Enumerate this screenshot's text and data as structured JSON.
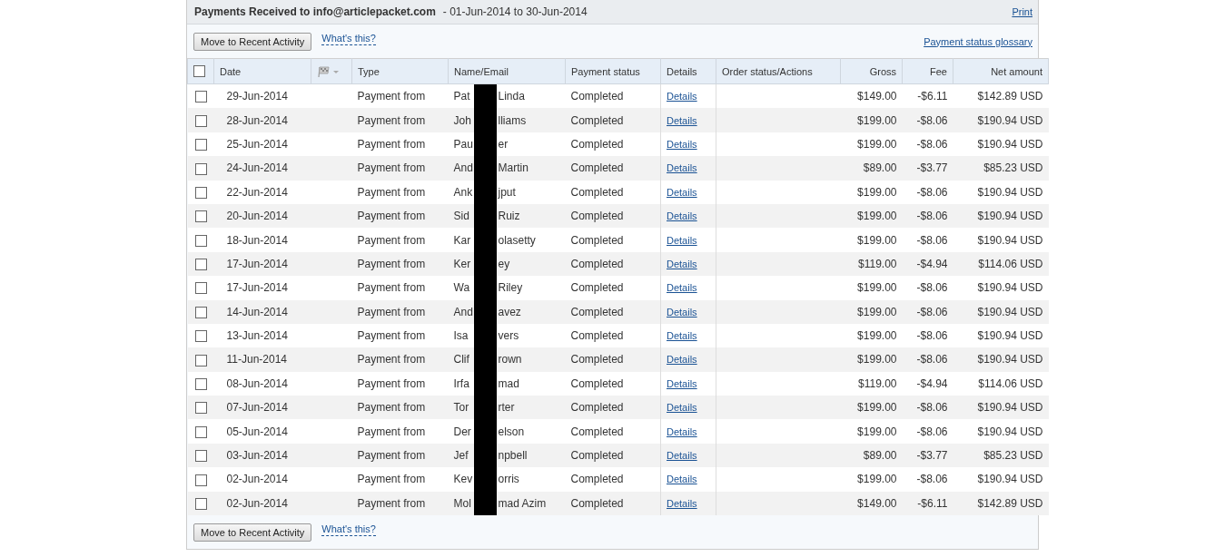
{
  "header": {
    "title": "Payments Received to info@articlepacket.com",
    "date_range": "- 01-Jun-2014 to 30-Jun-2014",
    "print_link": "Print"
  },
  "toolbar_top": {
    "button": "Move to Recent Activity",
    "help_link": "What's this?",
    "glossary_link": "Payment status glossary"
  },
  "table": {
    "select_all": {
      "checked": false
    },
    "columns": [
      "Date",
      "Type",
      "Name/Email",
      "Payment status",
      "Details",
      "Order status/Actions",
      "Gross",
      "Fee",
      "Net amount"
    ],
    "rows": [
      {
        "checked": false,
        "date": "29-Jun-2014",
        "type": "Payment from",
        "name_start": "Pat",
        "name_end": "Linda",
        "status": "Completed",
        "details": "Details",
        "gross": "$149.00",
        "fee": "-$6.11",
        "net": "$142.89 USD"
      },
      {
        "checked": false,
        "date": "28-Jun-2014",
        "type": "Payment from",
        "name_start": "Joh",
        "name_end": "lliams",
        "status": "Completed",
        "details": "Details",
        "gross": "$199.00",
        "fee": "-$8.06",
        "net": "$190.94 USD"
      },
      {
        "checked": false,
        "date": "25-Jun-2014",
        "type": "Payment from",
        "name_start": "Pau",
        "name_end": "er",
        "status": "Completed",
        "details": "Details",
        "gross": "$199.00",
        "fee": "-$8.06",
        "net": "$190.94 USD"
      },
      {
        "checked": false,
        "date": "24-Jun-2014",
        "type": "Payment from",
        "name_start": "And",
        "name_end": "Martin",
        "status": "Completed",
        "details": "Details",
        "gross": "$89.00",
        "fee": "-$3.77",
        "net": "$85.23 USD"
      },
      {
        "checked": false,
        "date": "22-Jun-2014",
        "type": "Payment from",
        "name_start": "Ank",
        "name_end": "jput",
        "status": "Completed",
        "details": "Details",
        "gross": "$199.00",
        "fee": "-$8.06",
        "net": "$190.94 USD"
      },
      {
        "checked": false,
        "date": "20-Jun-2014",
        "type": "Payment from",
        "name_start": "Sid",
        "name_end": "Ruiz",
        "status": "Completed",
        "details": "Details",
        "gross": "$199.00",
        "fee": "-$8.06",
        "net": "$190.94 USD"
      },
      {
        "checked": false,
        "date": "18-Jun-2014",
        "type": "Payment from",
        "name_start": "Kar",
        "name_end": "olasetty",
        "status": "Completed",
        "details": "Details",
        "gross": "$199.00",
        "fee": "-$8.06",
        "net": "$190.94 USD"
      },
      {
        "checked": false,
        "date": "17-Jun-2014",
        "type": "Payment from",
        "name_start": "Ker",
        "name_end": "ey",
        "status": "Completed",
        "details": "Details",
        "gross": "$119.00",
        "fee": "-$4.94",
        "net": "$114.06 USD"
      },
      {
        "checked": false,
        "date": "17-Jun-2014",
        "type": "Payment from",
        "name_start": "Wa",
        "name_end": "Riley",
        "status": "Completed",
        "details": "Details",
        "gross": "$199.00",
        "fee": "-$8.06",
        "net": "$190.94 USD"
      },
      {
        "checked": false,
        "date": "14-Jun-2014",
        "type": "Payment from",
        "name_start": "And",
        "name_end": "avez",
        "status": "Completed",
        "details": "Details",
        "gross": "$199.00",
        "fee": "-$8.06",
        "net": "$190.94 USD"
      },
      {
        "checked": false,
        "date": "13-Jun-2014",
        "type": "Payment from",
        "name_start": "Isa",
        "name_end": "vers",
        "status": "Completed",
        "details": "Details",
        "gross": "$199.00",
        "fee": "-$8.06",
        "net": "$190.94 USD"
      },
      {
        "checked": false,
        "date": "11-Jun-2014",
        "type": "Payment from",
        "name_start": "Clif",
        "name_end": "rown",
        "status": "Completed",
        "details": "Details",
        "gross": "$199.00",
        "fee": "-$8.06",
        "net": "$190.94 USD"
      },
      {
        "checked": false,
        "date": "08-Jun-2014",
        "type": "Payment from",
        "name_start": "Irfa",
        "name_end": "mad",
        "status": "Completed",
        "details": "Details",
        "gross": "$119.00",
        "fee": "-$4.94",
        "net": "$114.06 USD"
      },
      {
        "checked": false,
        "date": "07-Jun-2014",
        "type": "Payment from",
        "name_start": "Tor",
        "name_end": "rter",
        "status": "Completed",
        "details": "Details",
        "gross": "$199.00",
        "fee": "-$8.06",
        "net": "$190.94 USD"
      },
      {
        "checked": false,
        "date": "05-Jun-2014",
        "type": "Payment from",
        "name_start": "Der",
        "name_end": "elson",
        "status": "Completed",
        "details": "Details",
        "gross": "$199.00",
        "fee": "-$8.06",
        "net": "$190.94 USD"
      },
      {
        "checked": false,
        "date": "03-Jun-2014",
        "type": "Payment from",
        "name_start": "Jef",
        "name_end": "npbell",
        "status": "Completed",
        "details": "Details",
        "gross": "$89.00",
        "fee": "-$3.77",
        "net": "$85.23 USD"
      },
      {
        "checked": false,
        "date": "02-Jun-2014",
        "type": "Payment from",
        "name_start": "Kev",
        "name_end": "orris",
        "status": "Completed",
        "details": "Details",
        "gross": "$199.00",
        "fee": "-$8.06",
        "net": "$190.94 USD"
      },
      {
        "checked": false,
        "date": "02-Jun-2014",
        "type": "Payment from",
        "name_start": "Mol",
        "name_end": "mad Azim",
        "status": "Completed",
        "details": "Details",
        "gross": "$149.00",
        "fee": "-$6.11",
        "net": "$142.89 USD"
      }
    ]
  },
  "toolbar_bottom": {
    "button": "Move to Recent Activity",
    "help_link": "What's this?"
  }
}
